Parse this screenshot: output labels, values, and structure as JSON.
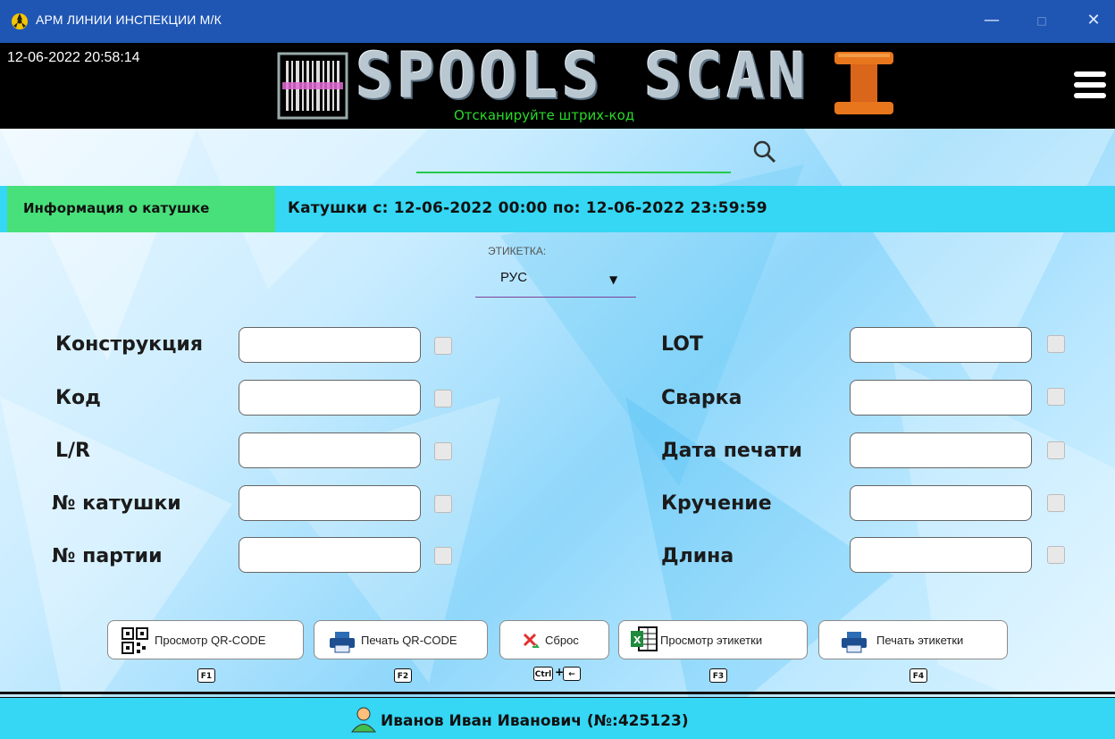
{
  "window": {
    "title": "АРМ ЛИНИИ ИНСПЕКЦИИ М/К",
    "min": "—",
    "max": "□",
    "close": "✕"
  },
  "header": {
    "datetime": "12-06-2022 20:58:14",
    "logo_text": "SPOOLS SCAN",
    "scan_hint": "Отсканируйте штрих-код"
  },
  "search": {
    "value": "",
    "placeholder": ""
  },
  "info": {
    "tab_label": "Информация о катушке",
    "range_text": "Катушки с: 12-06-2022 00:00 по: 12-06-2022 23:59:59"
  },
  "label_select": {
    "caption": "ЭТИКЕТКА:",
    "value": "РУС"
  },
  "fields_left": [
    {
      "label": "Конструкция",
      "value": ""
    },
    {
      "label": "Код",
      "value": ""
    },
    {
      "label": "L/R",
      "value": ""
    },
    {
      "label": "№ катушки",
      "value": ""
    },
    {
      "label": "№ партии",
      "value": ""
    }
  ],
  "fields_right": [
    {
      "label": "LOT",
      "value": ""
    },
    {
      "label": "Сварка",
      "value": ""
    },
    {
      "label": "Дата печати",
      "value": ""
    },
    {
      "label": "Кручение",
      "value": ""
    },
    {
      "label": "Длина",
      "value": ""
    }
  ],
  "buttons": [
    {
      "label": "Просмотр QR-CODE",
      "key": "F1",
      "icon": "qr-code-icon"
    },
    {
      "label": "Печать QR-CODE",
      "key": "F2",
      "icon": "printer-icon"
    },
    {
      "label": "Сброс",
      "key": "Ctrl",
      "key2": "←",
      "icon": "reset-icon"
    },
    {
      "label": "Просмотр этикетки",
      "key": "F3",
      "icon": "excel-icon"
    },
    {
      "label": "Печать этикетки",
      "key": "F4",
      "icon": "printer-icon"
    }
  ],
  "footer": {
    "user": "Иванов Иван Иванович (№:425123)"
  },
  "colors": {
    "titlebar": "#1f56b3",
    "info_bar": "#35d7f4",
    "info_tab": "#48e07a",
    "scan_hint": "#29d929"
  }
}
